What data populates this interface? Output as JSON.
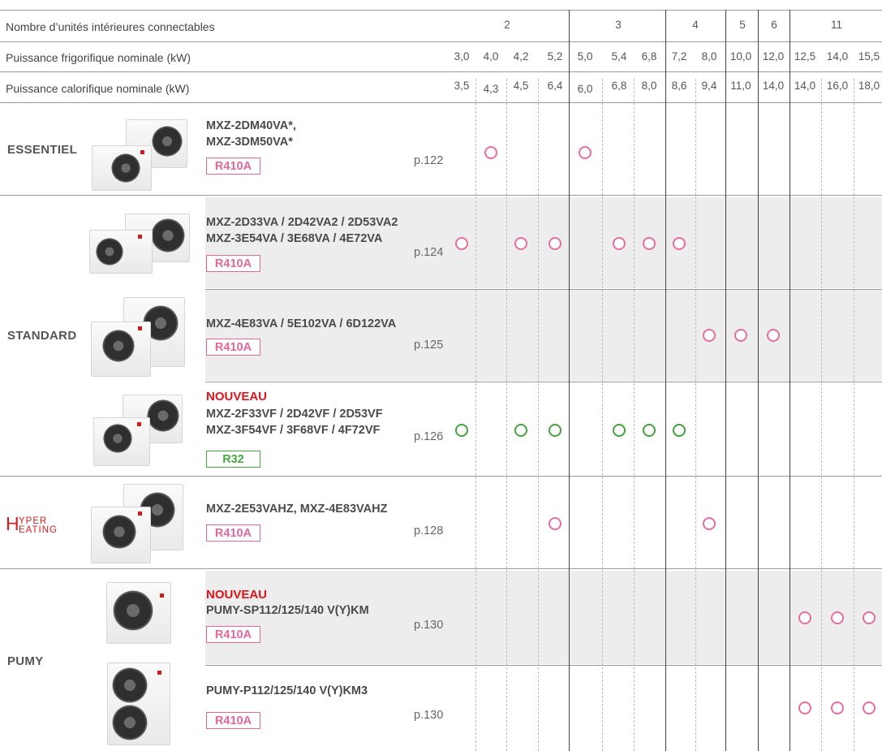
{
  "header": {
    "row1_label": "Nombre d’unités intérieures connectables",
    "row2_label": "Puissance frigorifique nominale (kW)",
    "row3_label": "Puissance calorifique nominale (kW)",
    "groups": [
      "2",
      "3",
      "4",
      "5",
      "6",
      "11"
    ],
    "cooling": [
      "3,0",
      "4,0",
      "4,2",
      "5,2",
      "5,0",
      "5,4",
      "6,8",
      "7,2",
      "8,0",
      "10,0",
      "12,0",
      "12,5",
      "14,0",
      "15,5"
    ],
    "heating": [
      "3,5",
      "4,3",
      "4,5",
      "6,4",
      "6,0",
      "6,8",
      "8,0",
      "8,6",
      "9,4",
      "11,0",
      "14,0",
      "14,0",
      "16,0",
      "18,0"
    ]
  },
  "families": {
    "essentiel": "ESSENTIEL",
    "standard": "STANDARD",
    "hyper_big": "H",
    "hyper_top": "YPER",
    "hyper_bottom": "EATING",
    "pumy": "PUMY"
  },
  "rows": [
    {
      "model_lines": [
        "MXZ-2DM40VA*,",
        "MXZ-3DM50VA*"
      ],
      "new_label": "",
      "refrigerant": "R410A",
      "page": "p.122",
      "available_columns": [
        1,
        4
      ]
    },
    {
      "model_lines": [
        "MXZ-2D33VA / 2D42VA2 / 2D53VA2",
        "MXZ-3E54VA / 3E68VA / 4E72VA"
      ],
      "new_label": "",
      "refrigerant": "R410A",
      "page": "p.124",
      "available_columns": [
        0,
        2,
        3,
        5,
        6,
        7
      ]
    },
    {
      "model_lines": [
        "MXZ-4E83VA / 5E102VA / 6D122VA"
      ],
      "new_label": "",
      "refrigerant": "R410A",
      "page": "p.125",
      "available_columns": [
        8,
        9,
        10
      ]
    },
    {
      "model_lines": [
        "MXZ-2F33VF / 2D42VF / 2D53VF",
        "MXZ-3F54VF / 3F68VF / 4F72VF"
      ],
      "new_label": "NOUVEAU",
      "refrigerant": "R32",
      "page": "p.126",
      "available_columns": [
        0,
        2,
        3,
        5,
        6,
        7
      ]
    },
    {
      "model_lines": [
        "MXZ-2E53VAHZ, MXZ-4E83VAHZ"
      ],
      "new_label": "",
      "refrigerant": "R410A",
      "page": "p.128",
      "available_columns": [
        3,
        8
      ]
    },
    {
      "model_lines": [
        "PUMY-SP112/125/140 V(Y)KM"
      ],
      "new_label": "NOUVEAU",
      "refrigerant": "R410A",
      "page": "p.130",
      "available_columns": [
        11,
        12,
        13
      ]
    },
    {
      "model_lines": [
        "PUMY-P112/125/140 V(Y)KM3"
      ],
      "new_label": "",
      "refrigerant": "R410A",
      "page": "p.130",
      "available_columns": [
        11,
        12,
        13
      ]
    }
  ],
  "colors": {
    "r410a": "#e3689a",
    "r32": "#46a83f",
    "new": "#e0121b",
    "hyper_heating": "#d61f1f",
    "band": "#ededed"
  }
}
